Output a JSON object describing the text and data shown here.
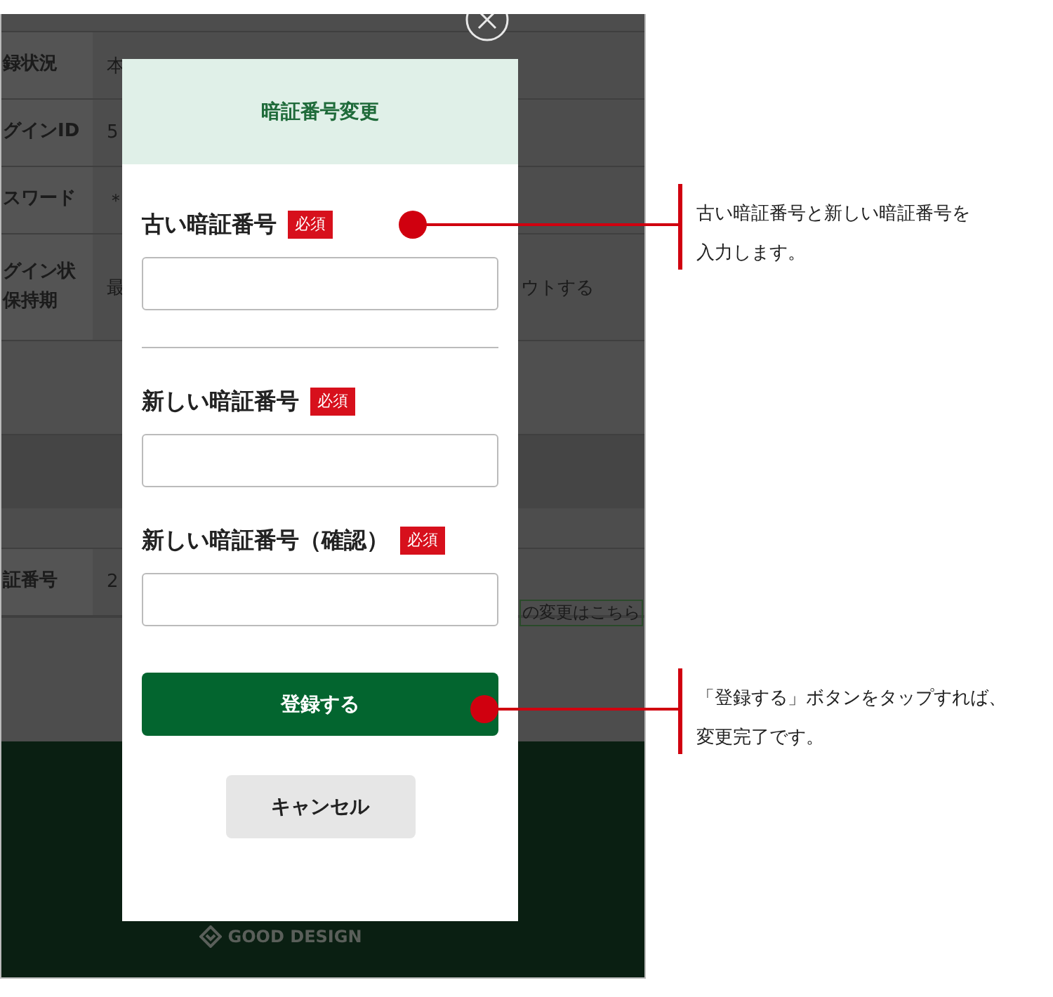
{
  "background_page": {
    "rows": [
      {
        "label": "録状況",
        "value": "本"
      },
      {
        "label": "グインID",
        "value": "5"
      },
      {
        "label": "スワード",
        "value": "＊"
      },
      {
        "label": "グイン状",
        "label_line2": "保持期",
        "value": "最",
        "value_right": "ウトする"
      },
      {
        "kind": "band"
      },
      {
        "label": "証番号",
        "value": "2",
        "link": "の変更はこちら"
      }
    ],
    "footer_logo": "GOOD DESIGN"
  },
  "dialog": {
    "title": "暗証番号変更",
    "fields": [
      {
        "label": "古い暗証番号",
        "badge": "必須",
        "divider_after": true
      },
      {
        "label": "新しい暗証番号",
        "badge": "必須",
        "divider_after": false
      },
      {
        "label": "新しい暗証番号（確認）",
        "badge": "必須",
        "divider_after": false
      }
    ],
    "submit_button": "登録する",
    "cancel_button": "キャンセル"
  },
  "annotations": [
    {
      "lines": [
        "古い暗証番号と新しい暗証番号を",
        "入力します。"
      ]
    },
    {
      "lines": [
        "「登録する」ボタンをタップすれば、",
        "変更完了です。"
      ]
    }
  ]
}
